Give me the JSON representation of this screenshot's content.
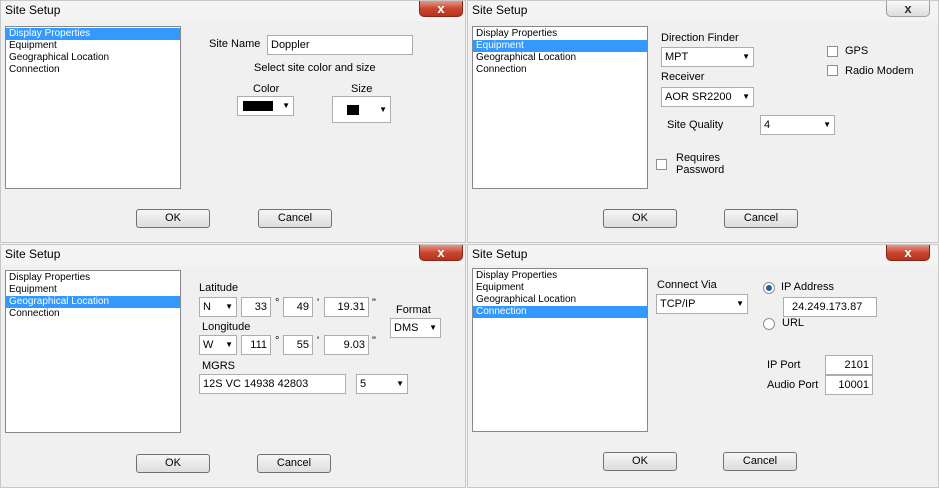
{
  "dialog_title": "Site Setup",
  "close_glyph": "x",
  "list_items": [
    "Display Properties",
    "Equipment",
    "Geographical Location",
    "Connection"
  ],
  "ok_label": "OK",
  "cancel_label": "Cancel",
  "display": {
    "site_name_label": "Site Name",
    "site_name_value": "Doppler",
    "select_text": "Select site color and size",
    "color_label": "Color",
    "size_label": "Size",
    "color_value": "#000000"
  },
  "equipment": {
    "direction_finder_label": "Direction Finder",
    "direction_finder_value": "MPT",
    "receiver_label": "Receiver",
    "receiver_value": "AOR SR2200",
    "site_quality_label": "Site Quality",
    "site_quality_value": "4",
    "gps_label": "GPS",
    "radio_modem_label": "Radio Modem",
    "requires_password_label_1": "Requires",
    "requires_password_label_2": "Password"
  },
  "geo": {
    "latitude_label": "Latitude",
    "lat_hemi": "N",
    "lat_deg": "33",
    "lat_min": "49",
    "lat_sec": "19.31",
    "longitude_label": "Longitude",
    "lon_hemi": "W",
    "lon_deg": "111",
    "lon_min": "55",
    "lon_sec": "9.03",
    "deg_mark": "°",
    "min_mark": "'",
    "sec_mark": "\"",
    "format_label": "Format",
    "format_value": "DMS",
    "mgrs_label": "MGRS",
    "mgrs_value": "12S VC 14938 42803",
    "mgrs_precision": "5"
  },
  "connection": {
    "connect_via_label": "Connect Via",
    "connect_via_value": "TCP/IP",
    "ip_address_label": "IP Address",
    "ip_address_value": "24.249.173.87",
    "url_label": "URL",
    "ip_port_label": "IP Port",
    "ip_port_value": "2101",
    "audio_port_label": "Audio Port",
    "audio_port_value": "10001"
  },
  "arrow_glyph": "▼"
}
